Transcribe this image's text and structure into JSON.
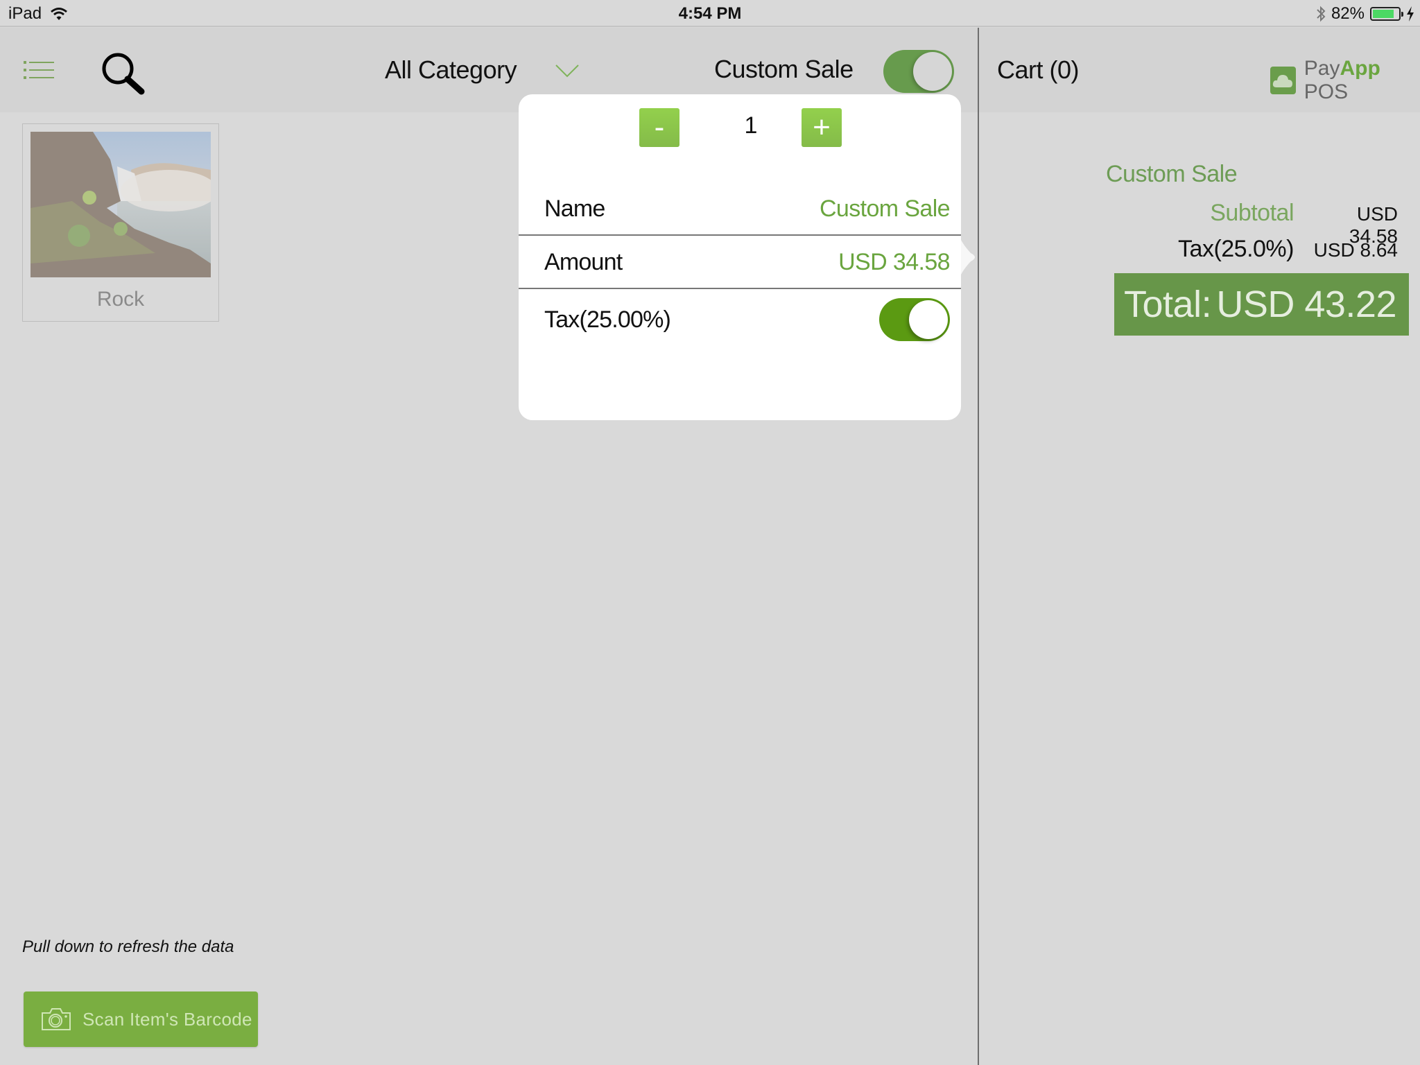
{
  "status_bar": {
    "device": "iPad",
    "time": "4:54 PM",
    "battery_percent": "82%",
    "battery_level": 0.82
  },
  "header": {
    "category_selected": "All Category",
    "custom_sale_label": "Custom Sale",
    "custom_sale_enabled": true
  },
  "products": [
    {
      "name": "Rock"
    }
  ],
  "refresh_hint": "Pull down to refresh the data",
  "scan_button_label": "Scan Item's Barcode",
  "cart": {
    "title": "Cart (0)",
    "logo": {
      "pay": "Pay",
      "app": "App",
      "pos": " POS"
    },
    "item_name": "Custom Sale",
    "subtotal_label": "Subtotal",
    "subtotal_value": "USD 34.58",
    "tax_label": "Tax(25.0%)",
    "tax_value": "USD 8.64",
    "total_label": "Total:",
    "total_value": "USD 43.22"
  },
  "popover": {
    "minus_label": "-",
    "plus_label": "+",
    "quantity": "1",
    "name_label": "Name",
    "name_value": "Custom Sale",
    "amount_label": "Amount",
    "amount_value": "USD 34.58",
    "tax_label": "Tax(25.00%)",
    "tax_enabled": true
  },
  "colors": {
    "accent_green": "#6aa53f",
    "toggle_green": "#5b9a12",
    "total_bg": "#679649",
    "scan_button_bg": "#7aae41"
  }
}
